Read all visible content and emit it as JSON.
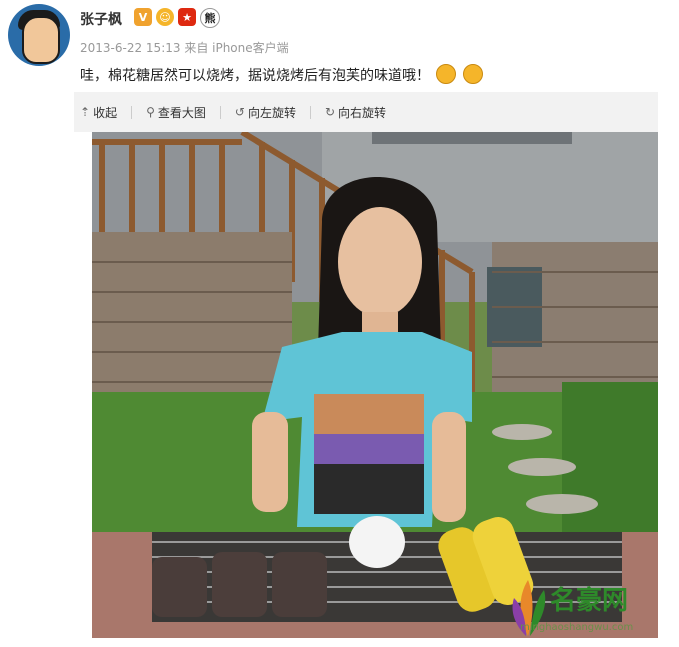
{
  "user": {
    "name": "张子枫",
    "badges": [
      "V",
      "☺",
      "★",
      "熊"
    ]
  },
  "post": {
    "meta": "2013-6-22 15:13 来自 iPhone客户端",
    "text": "哇，棉花糖居然可以烧烤，据说烧烤后有泡芙的味道哦！"
  },
  "toolbar": {
    "collapse": "收起",
    "view_large": "查看大图",
    "rotate_left": "向左旋转",
    "rotate_right": "向右旋转"
  },
  "watermark": {
    "title": "名豪网",
    "url": "minghaoshangwu.com"
  },
  "icons": {
    "collapse": "arrow-up-icon",
    "view_large": "magnifier-icon",
    "rotate_left": "rotate-left-icon",
    "rotate_right": "rotate-right-icon"
  },
  "colors": {
    "toolbar_bg": "#f2f2f2",
    "meta_text": "#999999",
    "accent_green": "#2e8a2a"
  }
}
